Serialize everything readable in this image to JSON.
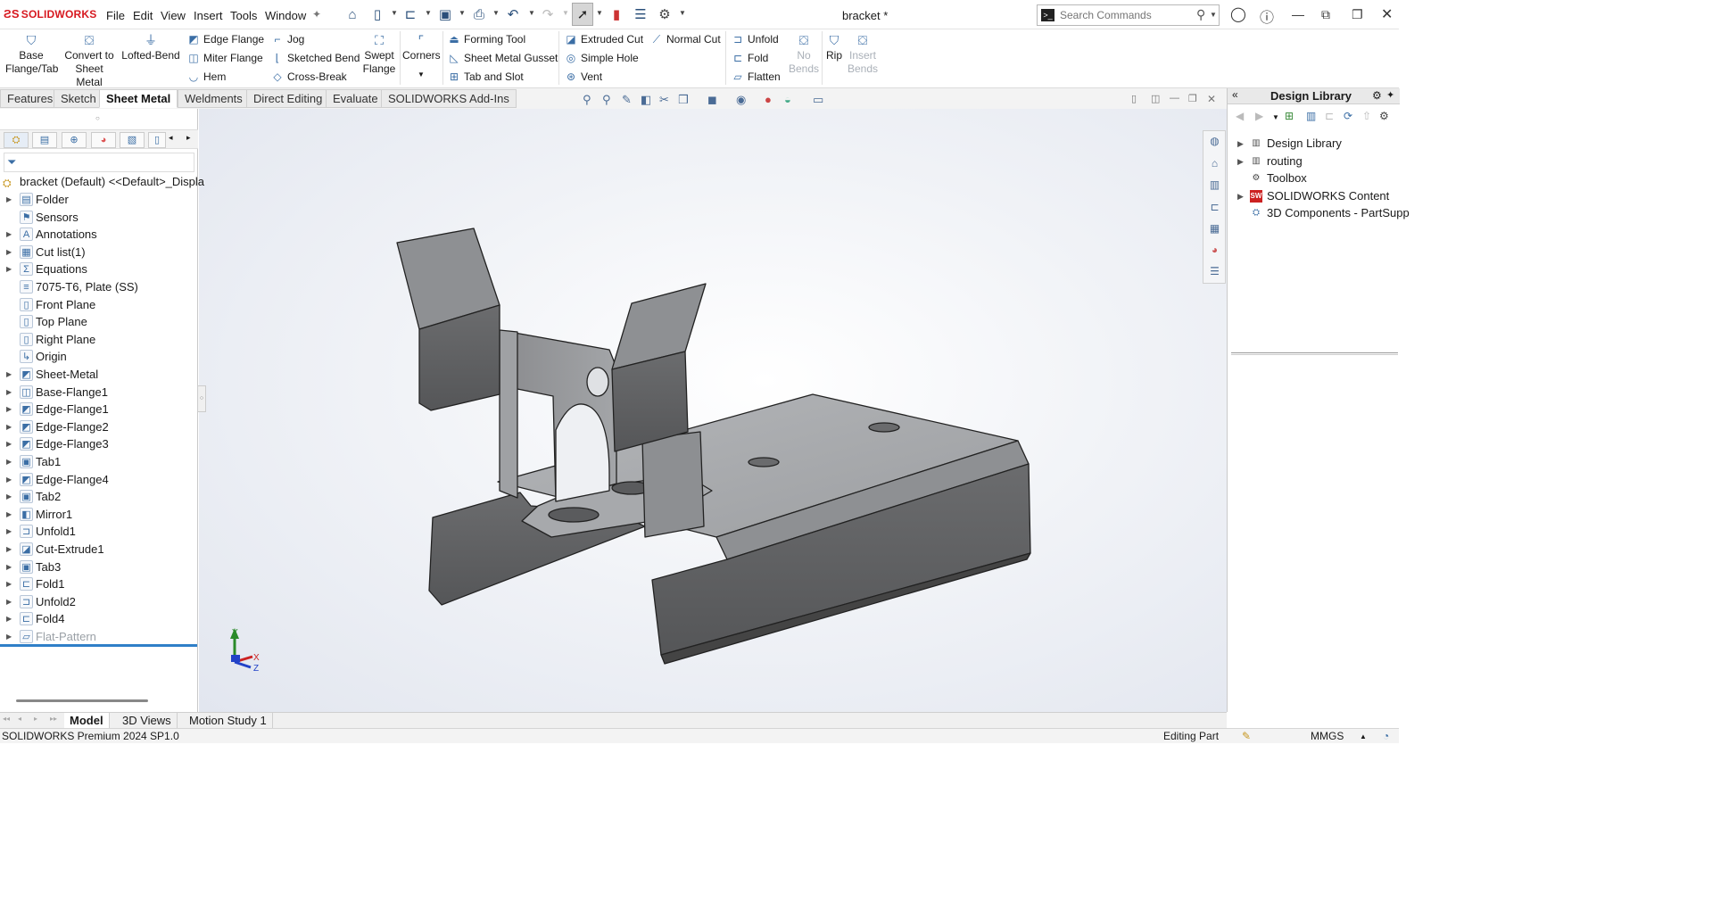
{
  "app": {
    "brand": "SOLIDWORKS",
    "document_title": "bracket *"
  },
  "menu": [
    "File",
    "Edit",
    "View",
    "Insert",
    "Tools",
    "Window"
  ],
  "search": {
    "placeholder": "Search Commands"
  },
  "ribbon": {
    "base_flange": "Base Flange/Tab",
    "convert": "Convert to Sheet Metal",
    "lofted_bend": "Lofted-Bend",
    "edge_flange": "Edge Flange",
    "miter_flange": "Miter Flange",
    "hem": "Hem",
    "jog": "Jog",
    "sketched_bend": "Sketched Bend",
    "cross_break": "Cross-Break",
    "swept_flange": "Swept Flange",
    "corners": "Corners",
    "forming_tool": "Forming Tool",
    "gusset": "Sheet Metal Gusset",
    "tab_and_slot": "Tab and Slot",
    "extruded_cut": "Extruded Cut",
    "simple_hole": "Simple Hole",
    "vent": "Vent",
    "normal_cut": "Normal Cut",
    "unfold": "Unfold",
    "fold": "Fold",
    "flatten": "Flatten",
    "no_bends": "No Bends",
    "rip": "Rip",
    "insert_bends": "Insert Bends"
  },
  "tabs": [
    "Features",
    "Sketch",
    "Sheet Metal",
    "Weldments",
    "Direct Editing",
    "Evaluate",
    "SOLIDWORKS Add-Ins"
  ],
  "feature_tree": {
    "root": "bracket (Default) <<Default>_Displa",
    "items": [
      {
        "label": "Folder",
        "exp": true
      },
      {
        "label": "Sensors",
        "exp": false
      },
      {
        "label": "Annotations",
        "exp": true
      },
      {
        "label": "Cut list(1)",
        "exp": true
      },
      {
        "label": "Equations",
        "exp": true
      },
      {
        "label": "7075-T6, Plate (SS)",
        "exp": false
      },
      {
        "label": "Front Plane",
        "exp": false
      },
      {
        "label": "Top Plane",
        "exp": false
      },
      {
        "label": "Right Plane",
        "exp": false
      },
      {
        "label": "Origin",
        "exp": false
      },
      {
        "label": "Sheet-Metal",
        "exp": true
      },
      {
        "label": "Base-Flange1",
        "exp": true
      },
      {
        "label": "Edge-Flange1",
        "exp": true
      },
      {
        "label": "Edge-Flange2",
        "exp": true
      },
      {
        "label": "Edge-Flange3",
        "exp": true
      },
      {
        "label": "Tab1",
        "exp": true
      },
      {
        "label": "Edge-Flange4",
        "exp": true
      },
      {
        "label": "Tab2",
        "exp": true
      },
      {
        "label": "Mirror1",
        "exp": true
      },
      {
        "label": "Unfold1",
        "exp": true
      },
      {
        "label": "Cut-Extrude1",
        "exp": true
      },
      {
        "label": "Tab3",
        "exp": true
      },
      {
        "label": "Fold1",
        "exp": true
      },
      {
        "label": "Unfold2",
        "exp": true
      },
      {
        "label": "Fold4",
        "exp": true
      },
      {
        "label": "Flat-Pattern",
        "exp": true
      }
    ]
  },
  "design_library": {
    "title": "Design Library",
    "items": [
      {
        "label": "Design Library",
        "exp": true
      },
      {
        "label": "routing",
        "exp": true
      },
      {
        "label": "Toolbox",
        "exp": false
      },
      {
        "label": "SOLIDWORKS Content",
        "exp": true
      },
      {
        "label": "3D Components - PartSupp",
        "exp": false
      }
    ]
  },
  "bottom_tabs": [
    "Model",
    "3D Views",
    "Motion Study 1"
  ],
  "status": {
    "left": "SOLIDWORKS Premium 2024 SP1.0",
    "mode": "Editing Part",
    "units": "MMGS"
  },
  "triad": {
    "x": "X",
    "y": "Y",
    "z": "Z"
  }
}
